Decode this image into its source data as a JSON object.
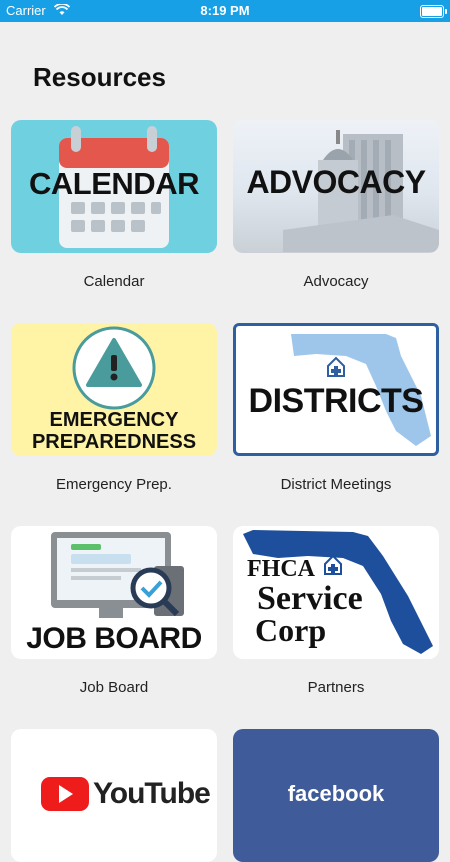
{
  "status": {
    "carrier": "Carrier",
    "time": "8:19 PM"
  },
  "title": "Resources",
  "tiles": [
    {
      "label": "Calendar",
      "image_text": "CALENDAR"
    },
    {
      "label": "Advocacy",
      "image_text": "ADVOCACY"
    },
    {
      "label": "Emergency Prep.",
      "image_text_1": "EMERGENCY",
      "image_text_2": "PREPAREDNESS"
    },
    {
      "label": "District Meetings",
      "image_text": "DISTRICTS"
    },
    {
      "label": "Job Board",
      "image_text": "JOB BOARD"
    },
    {
      "label": "Partners",
      "image_text_1": "FHCA",
      "image_text_2": "Service",
      "image_text_3": "Corp"
    },
    {
      "label": "",
      "image_text": "YouTube"
    },
    {
      "label": "",
      "image_text": "facebook"
    }
  ],
  "colors": {
    "status_bar": "#17a0e6",
    "calendar_bg": "#6fd0e0",
    "emergency_bg": "#fff3a6",
    "facebook_bg": "#3f5b99"
  }
}
